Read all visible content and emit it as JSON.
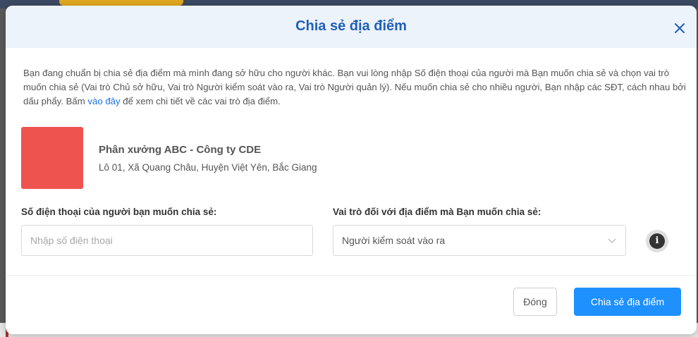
{
  "modal": {
    "title": "Chia sẻ địa điểm",
    "close_icon": "close-icon",
    "description_before_link": "Bạn đang chuẩn bị chia sẻ địa điểm mà mình đang sở hữu cho người khác. Bạn vui lòng nhập Số điện thoại của người mà Bạn muốn chia sẻ và chọn vai trò muốn chia sẻ (Vai trò Chủ sở hữu, Vai trò Người kiểm soát vào ra, Vai trò Người quản lý). Nếu muốn chia sẻ cho nhiều người, Bạn nhập các SĐT, cách nhau bởi dấu phẩy. Bấm ",
    "description_link": "vào đây",
    "description_after_link": " để xem chi tiết về các vai trò địa điểm."
  },
  "place": {
    "name": "Phân xưởng ABC - Công ty CDE",
    "address": "Lô 01, Xã Quang Châu, Huyện Việt Yên, Bắc Giang",
    "thumb_color": "#ef5350"
  },
  "form": {
    "phone_label": "Số điện thoại của người bạn muốn chia sẻ:",
    "phone_placeholder": "Nhập số điện thoại",
    "phone_value": "",
    "role_label": "Vai trò đối với địa điểm mà Bạn muốn chia sẻ:",
    "role_value": "Người kiểm soát vào ra",
    "info_icon": "info-icon"
  },
  "footer": {
    "close_label": "Đóng",
    "share_label": "Chia sẻ địa điểm"
  },
  "colors": {
    "accent": "#1e90ff",
    "title": "#1f5fb8",
    "link": "#1a73e8"
  }
}
